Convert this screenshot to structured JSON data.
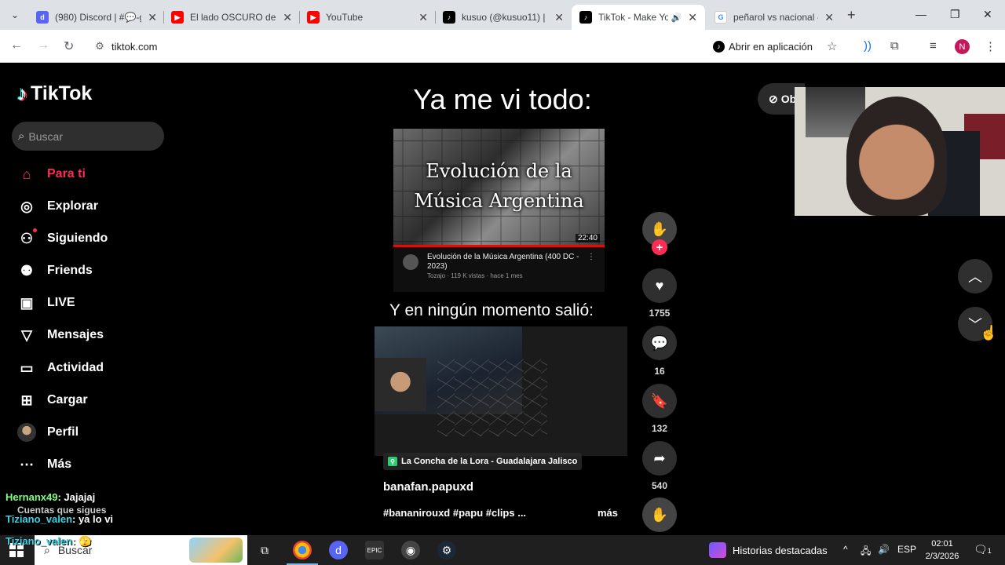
{
  "browser": {
    "tabs": [
      {
        "title": "(980) Discord | #💬-g",
        "color": "#5865f2",
        "icon": "discord"
      },
      {
        "title": "El lado OSCURO de A",
        "color": "#ff0000",
        "icon": "youtube"
      },
      {
        "title": "YouTube",
        "color": "#ff0000",
        "icon": "youtube"
      },
      {
        "title": "kusuo (@kusuo11) |",
        "color": "#000000",
        "icon": "tiktok"
      },
      {
        "title": "TikTok - Make Yo",
        "color": "#000000",
        "icon": "tiktok",
        "active": true
      },
      {
        "title": "peñarol vs nacional -",
        "color": "#4285f4",
        "icon": "google"
      }
    ],
    "url": "tiktok.com",
    "open_in_app": "Abrir en aplicación",
    "profile_initial": "N"
  },
  "sidebar": {
    "logo": "TikTok",
    "search_placeholder": "Buscar",
    "items": [
      {
        "label": "Para ti",
        "icon": "home-icon"
      },
      {
        "label": "Explorar",
        "icon": "compass-icon"
      },
      {
        "label": "Siguiendo",
        "icon": "following-icon"
      },
      {
        "label": "Friends",
        "icon": "friends-icon"
      },
      {
        "label": "LIVE",
        "icon": "live-icon"
      },
      {
        "label": "Mensajes",
        "icon": "send-icon"
      },
      {
        "label": "Actividad",
        "icon": "activity-icon"
      },
      {
        "label": "Cargar",
        "icon": "upload-icon"
      },
      {
        "label": "Perfil",
        "icon": "profile-avatar"
      },
      {
        "label": "Más",
        "icon": "more-icon"
      }
    ],
    "following_title": "Cuentas que sigues"
  },
  "chat": [
    {
      "user": "Hernanx49",
      "msg": ": Jajajaj"
    },
    {
      "user": "Tiziano_valen",
      "msg": ": ya lo vi"
    },
    {
      "user": "Tiziano_valen",
      "msg": ": 🫣"
    }
  ],
  "video": {
    "caption_top": "Ya me vi todo:",
    "thumb_line1": "Evolución de la",
    "thumb_line2": "Música Argentina",
    "thumb_duration": "22:40",
    "yt_title": "Evolución de la Música Argentina (400 DC - 2023)",
    "yt_sub": "Tozajo · 119 K vistas · hace 1 mes",
    "caption_bottom": "Y en ningún momento salió:",
    "location": "La Concha de la Lora - Guadalajara Jalisco",
    "author": "banafan.papuxd",
    "hashtags": "#bananirouxd #papu #clips ...",
    "more": "más"
  },
  "actions": {
    "likes": "1755",
    "comments": "16",
    "saves": "132",
    "shares": "540"
  },
  "right": {
    "obtain": "Ob"
  },
  "taskbar": {
    "search_placeholder": "Buscar",
    "highlights": "Historias destacadas",
    "lang": "ESP",
    "time": "02:01",
    "date": "2/3/2026",
    "notifications": "1"
  }
}
